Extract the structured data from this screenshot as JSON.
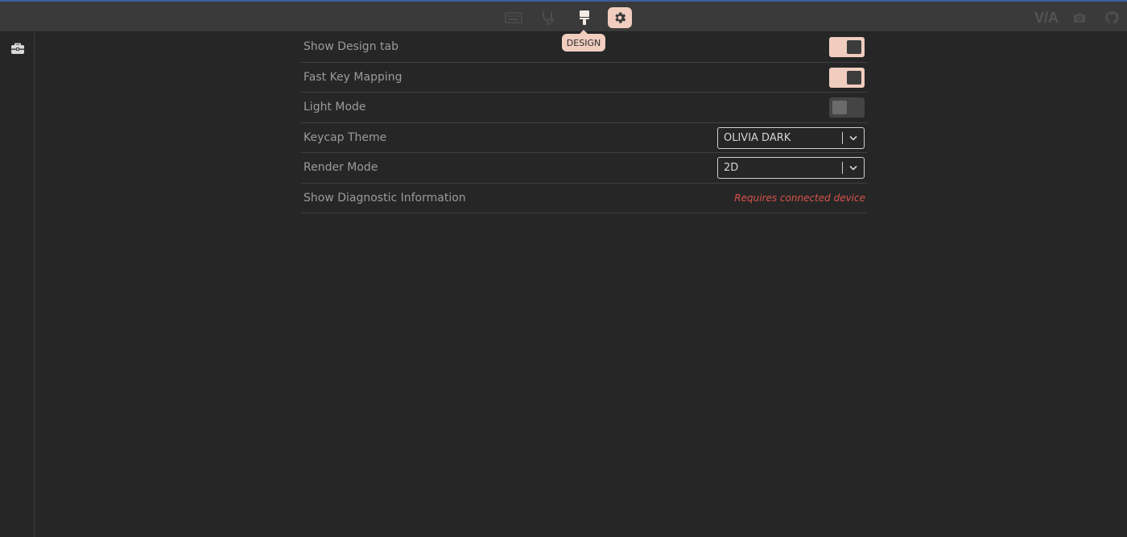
{
  "nav": {
    "icons": [
      "keyboard-icon",
      "stethoscope-icon",
      "brush-icon",
      "gear-icon"
    ],
    "active": "gear-icon",
    "tooltip": "DESIGN"
  },
  "header_right": {
    "logo": "V/A",
    "icons": [
      "camera-icon",
      "github-icon"
    ]
  },
  "sidebar": {
    "icons": [
      "toolbox-icon"
    ]
  },
  "settings": {
    "show_design_tab": {
      "label": "Show Design tab",
      "value": true
    },
    "fast_key_mapping": {
      "label": "Fast Key Mapping",
      "value": true
    },
    "light_mode": {
      "label": "Light Mode",
      "value": false
    },
    "keycap_theme": {
      "label": "Keycap Theme",
      "value": "OLIVIA DARK"
    },
    "render_mode": {
      "label": "Render Mode",
      "value": "2D"
    },
    "diagnostic": {
      "label": "Show Diagnostic Information",
      "status": "Requires connected device"
    }
  },
  "colors": {
    "accent": "#f0cdbf",
    "background": "#262626",
    "header": "#3a3a3a",
    "warning": "#d8534a"
  }
}
